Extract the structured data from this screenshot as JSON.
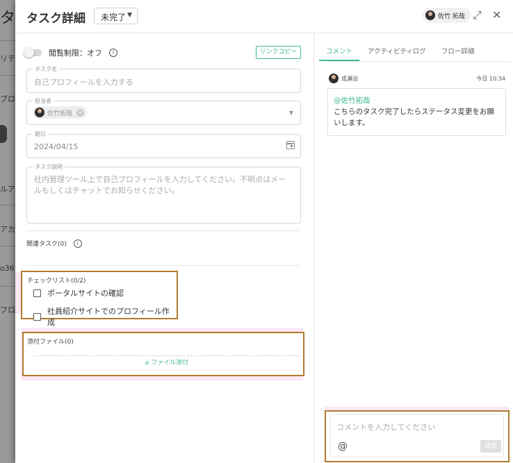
{
  "background": {
    "fragments": [
      "タ",
      "リテ",
      "プロ",
      "ルアカ",
      "アカ",
      "o365",
      "フロ"
    ]
  },
  "header": {
    "title": "タスク詳細",
    "status": "未完了",
    "user": "佐竹 拓哉"
  },
  "left": {
    "view_limit": "閲覧制限：オフ",
    "link_copy": "リンクコピー",
    "task_name": {
      "label": "タスク名",
      "placeholder": "自己プロフィールを入力する"
    },
    "assignee": {
      "label": "担当者",
      "value": "佐竹拓哉"
    },
    "due": {
      "label": "期日",
      "value": "2024/04/15"
    },
    "description": {
      "label": "タスク説明",
      "value": "社内管理ツール上で自己プロフィールを入力してください。不明点はメールもしくはチャットでお知らせください。"
    },
    "related": "関連タスク(0)",
    "checklist": {
      "title": "チェックリスト(0/2)",
      "items": [
        "ポータルサイトの確認",
        "社員紹介サイトでのプロフィール作成"
      ]
    },
    "attachments": {
      "title": "添付ファイル(0)",
      "button": "ファイル添付"
    }
  },
  "right": {
    "tabs": [
      "コメント",
      "アクティビティログ",
      "フロー詳細"
    ],
    "comment": {
      "author": "成瀬泊",
      "time": "今日 10:34",
      "mention": "@佐竹拓哉",
      "body": "こちらのタスク完了したらステータス変更をお願いします。"
    },
    "composer": {
      "placeholder": "コメントを入力してください",
      "at": "@",
      "send": "送信"
    }
  },
  "colors": {
    "accent": "#3fb88f",
    "highlight_border": "#b07a2a",
    "highlight_fill": "#fde8f7"
  }
}
